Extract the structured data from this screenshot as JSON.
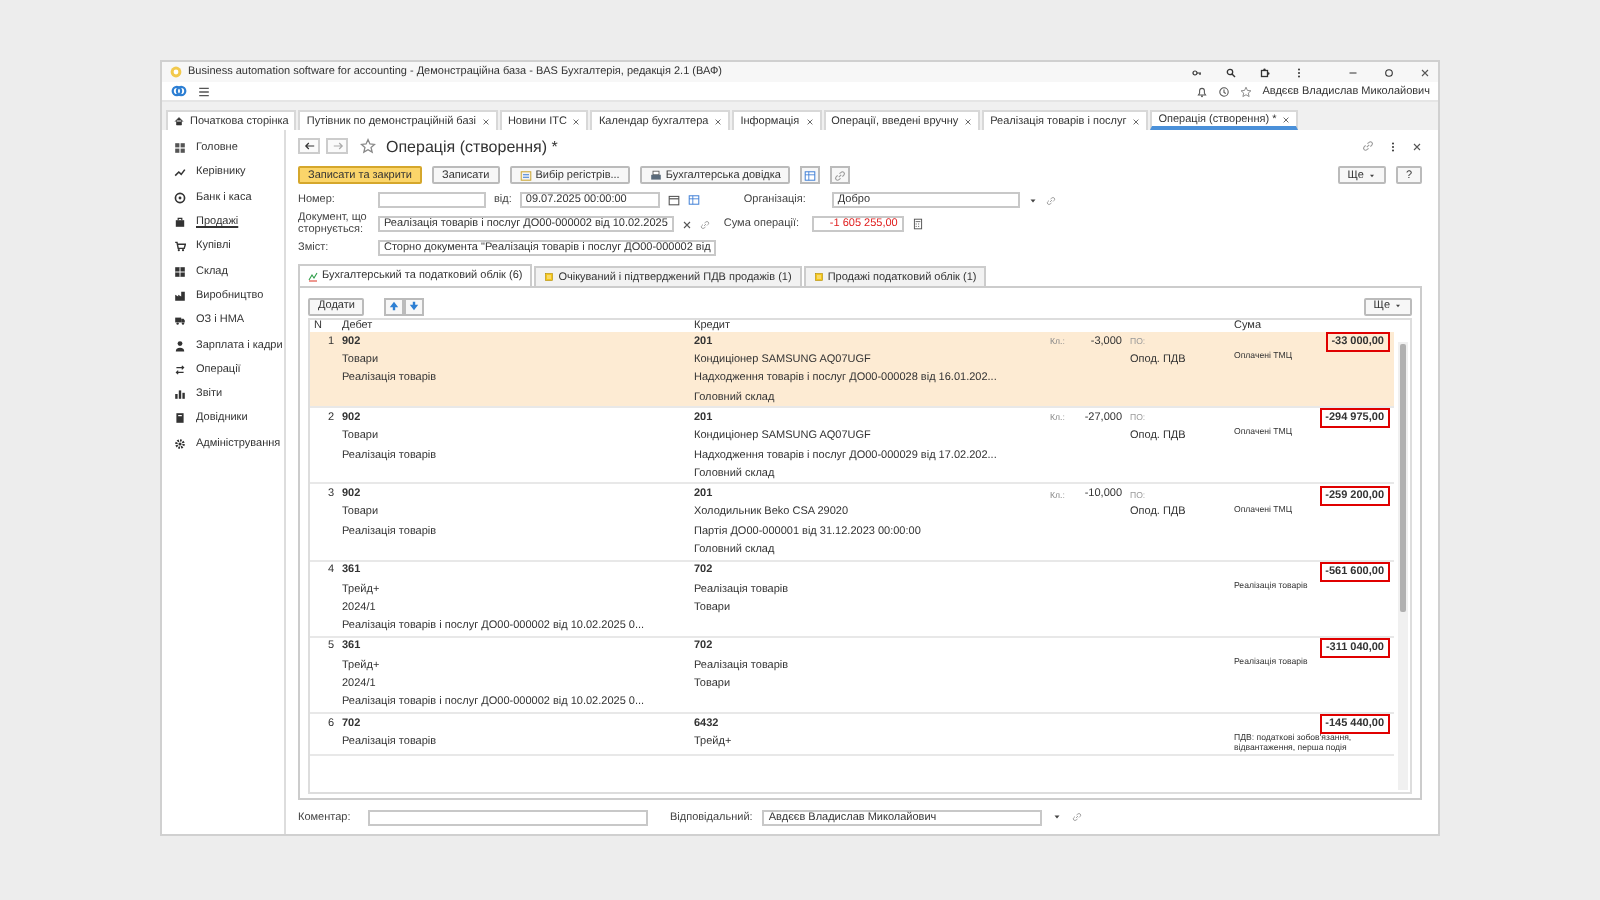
{
  "window": {
    "title": "Business automation software for accounting - Демонстраційна база - BAS Бухгалтерія, редакція 2.1 (ВАФ)",
    "user": "Авдєєв Владислав Миколайович"
  },
  "tabs": [
    {
      "label": "Початкова сторінка",
      "kind": "home",
      "selected": false
    },
    {
      "label": "Путівник по демонстраційній базі",
      "kind": "page",
      "selected": false
    },
    {
      "label": "Новини ІТС",
      "kind": "page",
      "selected": false
    },
    {
      "label": "Календар бухгалтера",
      "kind": "page",
      "selected": false
    },
    {
      "label": "Інформація",
      "kind": "page",
      "selected": false
    },
    {
      "label": "Операції, введені вручну",
      "kind": "page",
      "selected": false
    },
    {
      "label": "Реалізація товарів і послуг",
      "kind": "page",
      "selected": false
    },
    {
      "label": "Операція (створення) *",
      "kind": "page",
      "selected": true
    }
  ],
  "sidebar": {
    "items": [
      {
        "label": "Головне",
        "selected": false
      },
      {
        "label": "Керівнику",
        "selected": false
      },
      {
        "label": "Банк і каса",
        "selected": false
      },
      {
        "label": "Продажі",
        "selected": true
      },
      {
        "label": "Купівлі",
        "selected": false
      },
      {
        "label": "Склад",
        "selected": false
      },
      {
        "label": "Виробництво",
        "selected": false
      },
      {
        "label": "ОЗ і НМА",
        "selected": false
      },
      {
        "label": "Зарплата і кадри",
        "selected": false
      },
      {
        "label": "Операції",
        "selected": false
      },
      {
        "label": "Звіти",
        "selected": false
      },
      {
        "label": "Довідники",
        "selected": false
      },
      {
        "label": "Адміністрування",
        "selected": false
      }
    ]
  },
  "form": {
    "title": "Операція (створення) *",
    "buttons": [
      {
        "label": "Записати та закрити",
        "kind": "primary"
      },
      {
        "label": "Записати",
        "kind": "plain"
      },
      {
        "label": "Вибір регістрів...",
        "kind": "registers"
      },
      {
        "label": "Бухгалтерська довідка",
        "kind": "print"
      }
    ],
    "more_button": "Ще",
    "help_button": "?",
    "number": {
      "label": "Номер:"
    },
    "date": {
      "label": "від:",
      "value": "09.07.2025 00:00:00"
    },
    "organization": {
      "label": "Організація:",
      "value": "Добро"
    },
    "reversed_document": {
      "label": "Документ, що сторнується:",
      "value": "Реалізація товарів і послуг ДО00-000002 від 10.02.2025"
    },
    "operation_sum": {
      "label": "Сума операції:",
      "value": "-1 605 255,00"
    },
    "content": {
      "label": "Зміст:",
      "value": "Сторно документа \"Реалізація товарів і послуг ДО00-000002 від"
    },
    "subtabs": [
      {
        "label": "Бухгалтерський та податковий облік (6)",
        "selected": true
      },
      {
        "label": "Очікуваний і підтверджений ПДВ продажів (1)",
        "selected": false
      },
      {
        "label": "Продажі податковий облік (1)",
        "selected": false
      }
    ],
    "table_toolbar": {
      "add_button": "Додати",
      "more_button": "Ще"
    },
    "table": {
      "columns": [
        "N",
        "Дебет",
        "Кредит",
        "Сума"
      ],
      "rows": [
        {
          "n": "1",
          "selected": true,
          "debit": [
            "902",
            "Товари",
            "Реалізація товарів"
          ],
          "credit": [
            "201",
            "Кондиціонер SAMSUNG AQ07UGF",
            "Надходження товарів і послуг ДО00-000028 від 16.01.202...",
            "Головний склад"
          ],
          "quantity_label": "Кл.:",
          "quantity": "-3,000",
          "tax_label": "ПО:",
          "tax_status": "Опод. ПДВ",
          "amount": "-33 000,00",
          "highlighted": true,
          "note": "Оплачені ТМЦ"
        },
        {
          "n": "2",
          "selected": false,
          "debit": [
            "902",
            "Товари",
            "Реалізація товарів"
          ],
          "credit": [
            "201",
            "Кондиціонер SAMSUNG AQ07UGF",
            "Надходження товарів і послуг ДО00-000029 від 17.02.202...",
            "Головний склад"
          ],
          "quantity_label": "Кл.:",
          "quantity": "-27,000",
          "tax_label": "ПО:",
          "tax_status": "Опод. ПДВ",
          "amount": "-294 975,00",
          "highlighted": true,
          "note": "Оплачені ТМЦ"
        },
        {
          "n": "3",
          "selected": false,
          "debit": [
            "902",
            "Товари",
            "Реалізація товарів"
          ],
          "credit": [
            "201",
            "Холодильник Beko CSA 29020",
            "Партія ДО00-000001 від 31.12.2023 00:00:00",
            "Головний склад"
          ],
          "quantity_label": "Кл.:",
          "quantity": "-10,000",
          "tax_label": "ПО:",
          "tax_status": "Опод. ПДВ",
          "amount": "-259 200,00",
          "highlighted": true,
          "note": "Оплачені ТМЦ"
        },
        {
          "n": "4",
          "selected": false,
          "debit": [
            "361",
            "Трейд+",
            "2024/1",
            "Реалізація товарів і послуг ДО00-000002 від 10.02.2025 0..."
          ],
          "credit": [
            "702",
            "Реалізація товарів",
            "Товари"
          ],
          "amount": "-561 600,00",
          "highlighted": true,
          "note": "Реалізація товарів"
        },
        {
          "n": "5",
          "selected": false,
          "debit": [
            "361",
            "Трейд+",
            "2024/1",
            "Реалізація товарів і послуг ДО00-000002 від 10.02.2025 0..."
          ],
          "credit": [
            "702",
            "Реалізація товарів",
            "Товари"
          ],
          "amount": "-311 040,00",
          "highlighted": true,
          "note": "Реалізація товарів"
        },
        {
          "n": "6",
          "selected": false,
          "debit": [
            "702",
            "Реалізація товарів"
          ],
          "credit": [
            "6432",
            "Трейд+"
          ],
          "amount": "-145 440,00",
          "highlighted": true,
          "note": "ПДВ: податкові зобов'язання, відвантаження, перша подія"
        }
      ]
    },
    "comment": {
      "label": "Коментар:"
    },
    "responsible": {
      "label": "Відповідальний:",
      "value": "Авдєєв Владислав Миколайович"
    }
  }
}
